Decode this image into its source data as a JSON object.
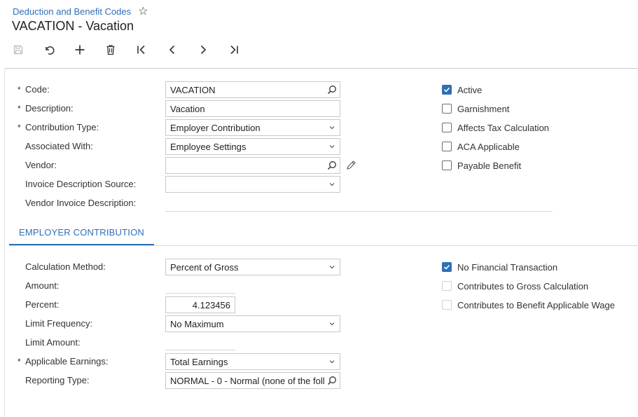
{
  "header": {
    "breadcrumb": "Deduction and Benefit Codes",
    "title": "VACATION - Vacation"
  },
  "toolbar": {
    "buttons": [
      "save-icon",
      "undo-icon",
      "add-icon",
      "delete-icon",
      "first-icon",
      "previous-icon",
      "next-icon",
      "last-icon"
    ]
  },
  "form": {
    "code_label": "Code:",
    "code_value": "VACATION",
    "description_label": "Description:",
    "description_value": "Vacation",
    "contribution_type_label": "Contribution Type:",
    "contribution_type_value": "Employer Contribution",
    "associated_with_label": "Associated With:",
    "associated_with_value": "Employee Settings",
    "vendor_label": "Vendor:",
    "vendor_value": "",
    "invoice_desc_source_label": "Invoice Description Source:",
    "invoice_desc_source_value": "",
    "vendor_invoice_desc_label": "Vendor Invoice Description:",
    "required_marker": "*"
  },
  "flags": {
    "active": {
      "label": "Active",
      "checked": true
    },
    "garnishment": {
      "label": "Garnishment",
      "checked": false
    },
    "affects_tax": {
      "label": "Affects Tax Calculation",
      "checked": false
    },
    "aca": {
      "label": "ACA Applicable",
      "checked": false
    },
    "payable_benefit": {
      "label": "Payable Benefit",
      "checked": false
    }
  },
  "tab": {
    "label": "EMPLOYER CONTRIBUTION"
  },
  "employer": {
    "calc_method_label": "Calculation Method:",
    "calc_method_value": "Percent of Gross",
    "amount_label": "Amount:",
    "percent_label": "Percent:",
    "percent_value": "4.123456",
    "limit_freq_label": "Limit Frequency:",
    "limit_freq_value": "No Maximum",
    "limit_amount_label": "Limit Amount:",
    "applicable_earnings_label": "Applicable Earnings:",
    "applicable_earnings_value": "Total Earnings",
    "reporting_type_label": "Reporting Type:",
    "reporting_type_value": "NORMAL - 0 - Normal (none of the foll"
  },
  "employer_flags": {
    "no_financial": {
      "label": "No Financial Transaction",
      "checked": true
    },
    "contrib_gross": {
      "label": "Contributes to Gross Calculation",
      "checked": false
    },
    "contrib_benefit": {
      "label": "Contributes to Benefit Applicable Wage",
      "checked": false
    }
  },
  "colors": {
    "accent": "#2f6fb5"
  }
}
